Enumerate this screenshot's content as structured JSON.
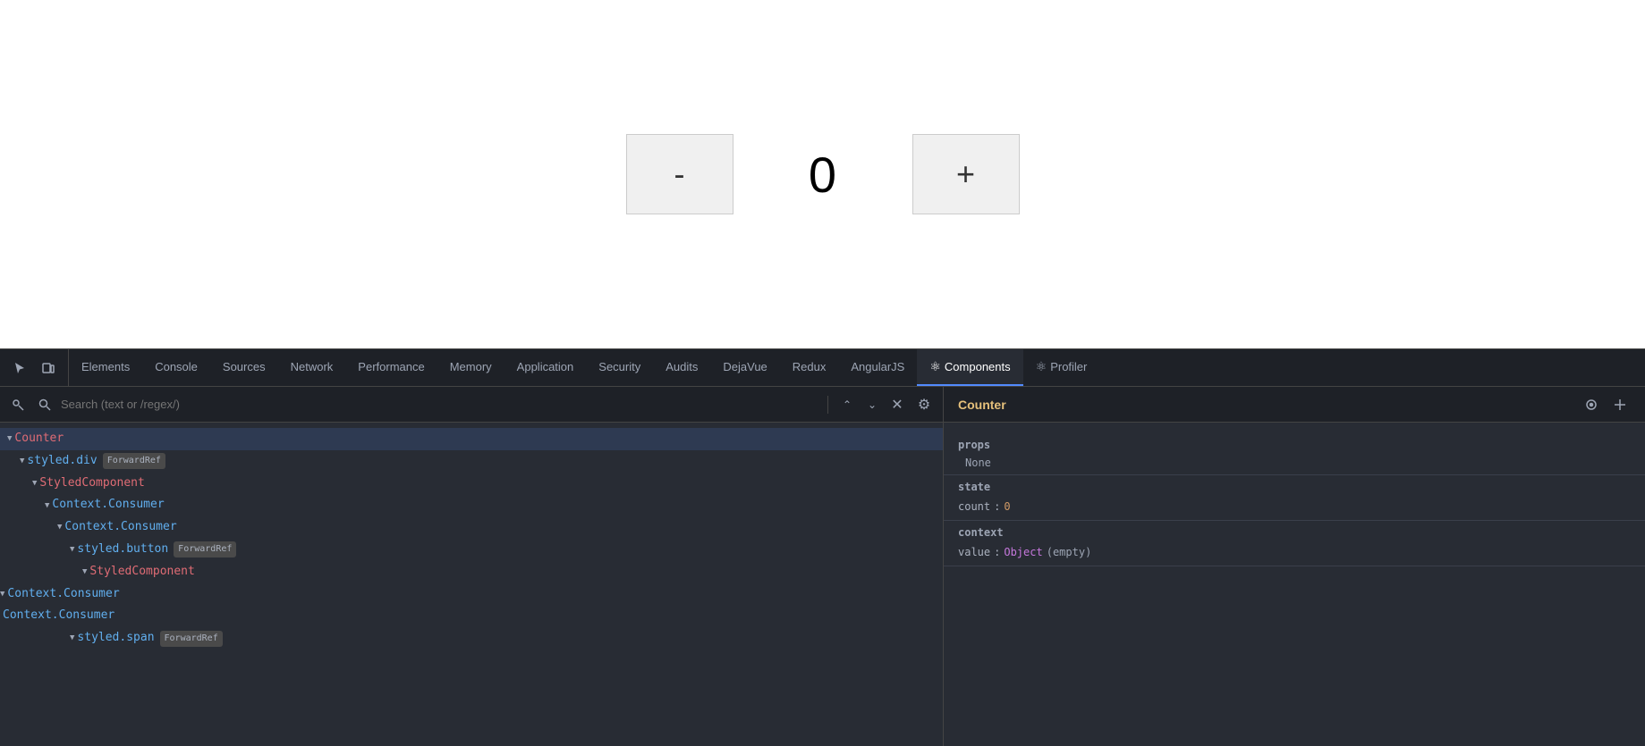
{
  "app": {
    "counter_value": "0",
    "decrement_label": "-",
    "increment_label": "+"
  },
  "devtools": {
    "tabs": [
      {
        "id": "elements",
        "label": "Elements",
        "active": false,
        "icon": ""
      },
      {
        "id": "console",
        "label": "Console",
        "active": false,
        "icon": ""
      },
      {
        "id": "sources",
        "label": "Sources",
        "active": false,
        "icon": ""
      },
      {
        "id": "network",
        "label": "Network",
        "active": false,
        "icon": ""
      },
      {
        "id": "performance",
        "label": "Performance",
        "active": false,
        "icon": ""
      },
      {
        "id": "memory",
        "label": "Memory",
        "active": false,
        "icon": ""
      },
      {
        "id": "application",
        "label": "Application",
        "active": false,
        "icon": ""
      },
      {
        "id": "security",
        "label": "Security",
        "active": false,
        "icon": ""
      },
      {
        "id": "audits",
        "label": "Audits",
        "active": false,
        "icon": ""
      },
      {
        "id": "dejavue",
        "label": "DejaVue",
        "active": false,
        "icon": ""
      },
      {
        "id": "redux",
        "label": "Redux",
        "active": false,
        "icon": ""
      },
      {
        "id": "angularjs",
        "label": "AngularJS",
        "active": false,
        "icon": ""
      },
      {
        "id": "components",
        "label": "Components",
        "active": true,
        "icon": "⚛"
      },
      {
        "id": "profiler",
        "label": "Profiler",
        "active": false,
        "icon": "⚛"
      }
    ],
    "search": {
      "placeholder": "Search (text or /regex/)"
    },
    "tree": {
      "items": [
        {
          "level": 0,
          "arrow": "▼",
          "name": "Counter",
          "color": "red",
          "badge": "",
          "id": "counter"
        },
        {
          "level": 1,
          "arrow": "▼",
          "name": "styled.div",
          "color": "blue",
          "badge": "ForwardRef",
          "id": "styled-div"
        },
        {
          "level": 2,
          "arrow": "▼",
          "name": "StyledComponent",
          "color": "red",
          "badge": "",
          "id": "styled-component-1"
        },
        {
          "level": 3,
          "arrow": "▼",
          "name": "Context.Consumer",
          "color": "blue",
          "badge": "",
          "id": "context-consumer-1"
        },
        {
          "level": 4,
          "arrow": "▼",
          "name": "Context.Consumer",
          "color": "blue",
          "badge": "",
          "id": "context-consumer-2"
        },
        {
          "level": 5,
          "arrow": "▼",
          "name": "styled.button",
          "color": "blue",
          "badge": "ForwardRef",
          "id": "styled-button"
        },
        {
          "level": 6,
          "arrow": "▼",
          "name": "StyledComponent",
          "color": "red",
          "badge": "",
          "id": "styled-component-2"
        },
        {
          "level": 7,
          "arrow": "▼",
          "name": "Context.Consumer",
          "color": "blue",
          "badge": "",
          "id": "context-consumer-3"
        },
        {
          "level": 8,
          "arrow": " ",
          "name": "Context.Consumer",
          "color": "blue",
          "badge": "",
          "id": "context-consumer-4"
        },
        {
          "level": 5,
          "arrow": "▼",
          "name": "styled.span",
          "color": "blue",
          "badge": "ForwardRef",
          "id": "styled-span"
        }
      ]
    },
    "props_panel": {
      "component_name": "Counter",
      "sections": {
        "props": {
          "title": "props",
          "value": "None"
        },
        "state": {
          "title": "state",
          "rows": [
            {
              "key": "count",
              "colon": ":",
              "value": "0",
              "type": "number"
            }
          ]
        },
        "context": {
          "title": "context",
          "rows": [
            {
              "key": "value",
              "colon": ":",
              "value": "Object",
              "suffix": "(empty)",
              "type": "object"
            }
          ]
        }
      }
    }
  }
}
